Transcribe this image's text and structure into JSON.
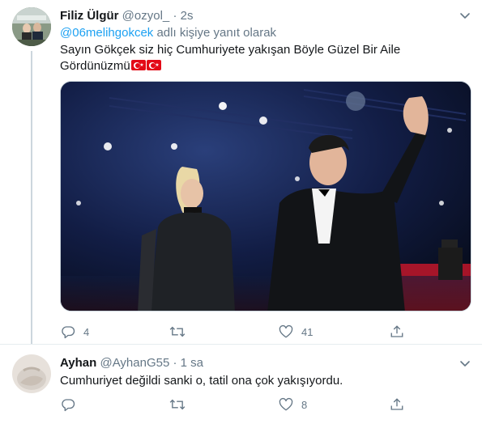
{
  "tweet1": {
    "name": "Filiz Ülgür",
    "handle": "@ozyol_",
    "separator": "·",
    "time": "2s",
    "reply_mention": "@06melihgokcek",
    "reply_suffix": " adlı kişiye yanıt olarak",
    "text_line1": "Sayın Gökçek siz hiç Cumhuriyete yakışan Böyle  Güzel Bir Aile",
    "text_line2": "Gördünüzmü",
    "stats": {
      "replies": "4",
      "retweets": "",
      "likes": "41"
    },
    "icons": {
      "reply": "reply-icon",
      "retweet": "retweet-icon",
      "like": "heart-icon",
      "share": "share-icon",
      "menu": "chevron-down-icon"
    }
  },
  "tweet2": {
    "name": "Ayhan",
    "handle": "@AyhanG55",
    "separator": "·",
    "time": "1 sa",
    "text": "Cumhuriyet değildi sanki o, tatil ona çok yakışıyordu.",
    "stats": {
      "replies": "",
      "retweets": "",
      "likes": "8"
    }
  },
  "colors": {
    "link": "#1da1f2",
    "muted": "#657786",
    "flag": "#e30a17",
    "line": "#ccd6dd"
  }
}
